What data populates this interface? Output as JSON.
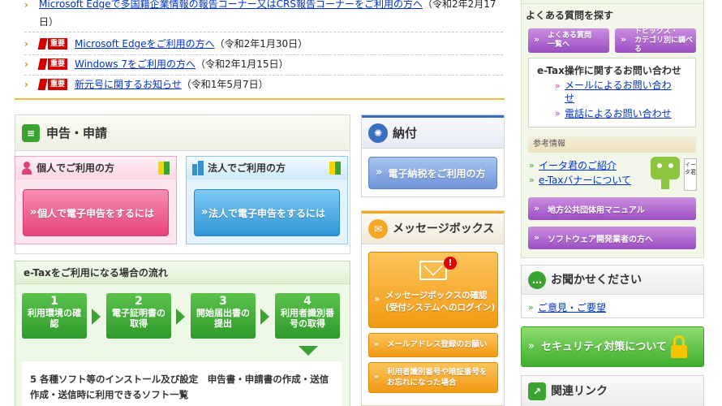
{
  "news": [
    {
      "label": "Microsoft Edgeで多国籍企業情報の報告コーナー又はCRS報告コーナーをご利用の方へ",
      "date": "（令和2年2月17",
      "date2": "日）",
      "important": false
    },
    {
      "label": "Microsoft Edgeをご利用の方へ",
      "date": "（令和2年1月30日）",
      "important": true
    },
    {
      "label": "Windows 7をご利用の方へ",
      "date": "（令和2年1月15日）",
      "important": true
    },
    {
      "label": "新元号に関するお知らせ",
      "date": "（令和1年5月7日）",
      "important": true
    }
  ],
  "badge_label": "重要",
  "filing": {
    "title": "申告・申請",
    "individual": {
      "title": "個人でご利用の方",
      "button": "個人で電子申告をするには"
    },
    "corporate": {
      "title": "法人でご利用の方",
      "button": "法人で電子申告をするには"
    }
  },
  "flow": {
    "title": "e-Taxをご利用になる場合の流れ",
    "steps": [
      {
        "num": "1",
        "label": "利用環境の確認"
      },
      {
        "num": "2",
        "label": "電子証明書の取得"
      },
      {
        "num": "3",
        "label": "開始届出書の提出"
      },
      {
        "num": "4",
        "label": "利用者識別番号の取得"
      }
    ],
    "step5_line1": "5 各種ソフト等のインストール及び設定　申告書・申請書の作成・送信",
    "step5_line2": "作成・送信時に利用できるソフト一覧"
  },
  "payment": {
    "title": "納付",
    "button": "電子納税をご利用の方"
  },
  "messagebox": {
    "title": "メッセージボックス",
    "main_button_line1": "メッセージボックスの確認",
    "main_button_line2": "(受付システムへのログイン)",
    "btn_email": "メールアドレス登録のお願い",
    "btn_forgot_line1": "利用者識別番号や暗証番号を",
    "btn_forgot_line2": "お忘れになった場合",
    "alert": "!"
  },
  "faq": {
    "title": "よくある質問を探す",
    "btn1_line1": "よくある質問",
    "btn1_line2": "一覧へ",
    "btn2_line1": "トピックス・",
    "btn2_line2": "カテゴリ別に調べる"
  },
  "inquiry": {
    "title": "e-Tax操作に関するお問い合わせ",
    "email_line1": "メールによるお問い合わ",
    "email_line2": "せ",
    "phone": "電話によるお問い合わせ"
  },
  "reference": {
    "title": "参考情報",
    "link1": "イータ君のご紹介",
    "link2": "e-Taxバナーについて",
    "mascot_tag": "イータ君"
  },
  "manuals": {
    "local_gov": "地方公共団体用マニュアル",
    "software_dev": "ソフトウェア開発業者の方へ"
  },
  "feedback": {
    "title": "お聞かせください",
    "link": "ご意見・ご要望"
  },
  "security": {
    "label": "セキュリティ対策について"
  },
  "related": {
    "title": "関連リンク"
  },
  "colors": {
    "pink": "#f06496",
    "blue": "#3aa0e0",
    "green": "#3aa332",
    "orange": "#f5a623",
    "purple": "#a55ac8"
  }
}
